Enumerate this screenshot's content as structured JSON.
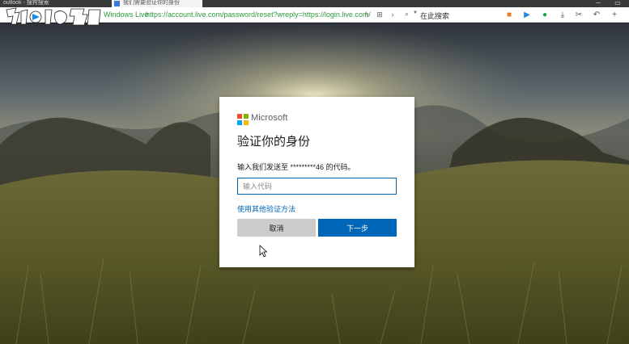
{
  "browser": {
    "tab_left_title": "outlook - 搜狗搜索",
    "tab_active_title": "我们需要验证你的身份",
    "site_name": "Windows Live",
    "url": "https://account.live.com/password/reset?wreply=https://login.live.com/",
    "search_placeholder": "在此搜索"
  },
  "dialog": {
    "brand": "Microsoft",
    "title": "验证你的身份",
    "description": "输入我们发送至 *********46 的代码。",
    "code_placeholder": "输入代码",
    "alt_method_link": "使用其他验证方法",
    "cancel_label": "取消",
    "next_label": "下一步"
  },
  "colors": {
    "accent": "#0067b8",
    "cancel_bg": "#cccccc",
    "ms_red": "#f25022",
    "ms_green": "#7fba00",
    "ms_blue": "#00a4ef",
    "ms_yellow": "#ffb900",
    "url_green": "#2e9a3c"
  },
  "icons": [
    "bolt-icon",
    "grid-icon",
    "forward-icon",
    "search-icon",
    "video-icon",
    "play-icon",
    "chat-icon",
    "download-icon",
    "cut-icon",
    "undo-icon",
    "plus-icon"
  ]
}
